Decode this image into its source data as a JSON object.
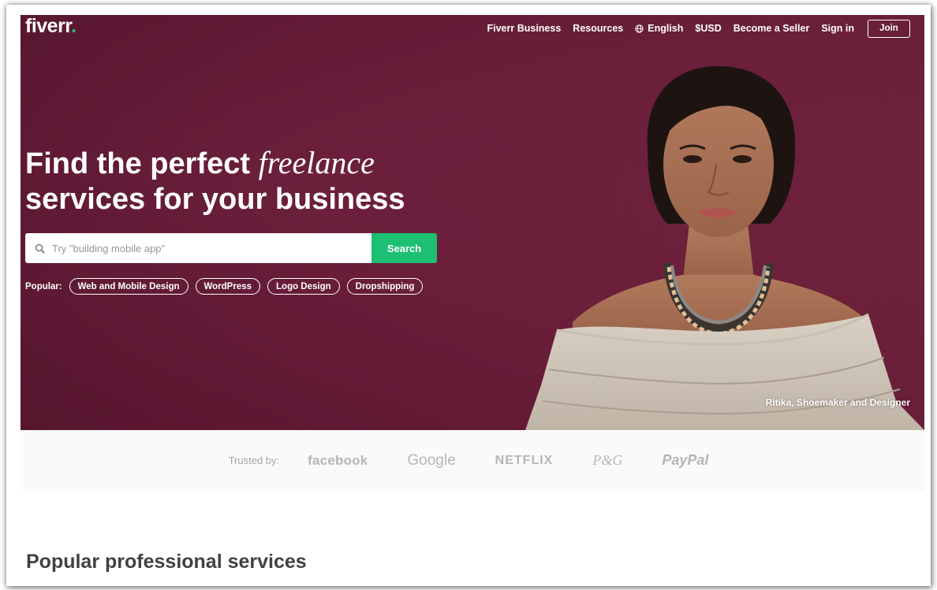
{
  "header": {
    "logo_text": "fiverr",
    "logo_dot": ".",
    "nav": {
      "business": "Fiverr Business",
      "resources": "Resources",
      "language": "English",
      "currency": "$USD",
      "become_seller": "Become a Seller",
      "sign_in": "Sign in",
      "join": "Join"
    }
  },
  "hero": {
    "headline_part1": "Find the perfect ",
    "headline_italic": "freelance",
    "headline_part2": "services for your business",
    "search": {
      "placeholder": "Try \"building mobile app\"",
      "button_label": "Search"
    },
    "popular": {
      "label": "Popular:",
      "items": [
        "Web and Mobile Design",
        "WordPress",
        "Logo Design",
        "Dropshipping"
      ]
    },
    "caption": "Ritika, Shoemaker and Designer"
  },
  "trusted": {
    "label": "Trusted by:",
    "brands": [
      "facebook",
      "Google",
      "NETFLIX",
      "P&G",
      "PayPal"
    ]
  },
  "sections": {
    "popular_services_title": "Popular professional services"
  },
  "colors": {
    "hero_bg": "#6b1a38",
    "accent_green": "#1dbf73",
    "text_dark": "#404145",
    "brand_gray": "#b5b6ba"
  },
  "icons": {
    "search": "search-icon",
    "globe": "globe-icon"
  }
}
